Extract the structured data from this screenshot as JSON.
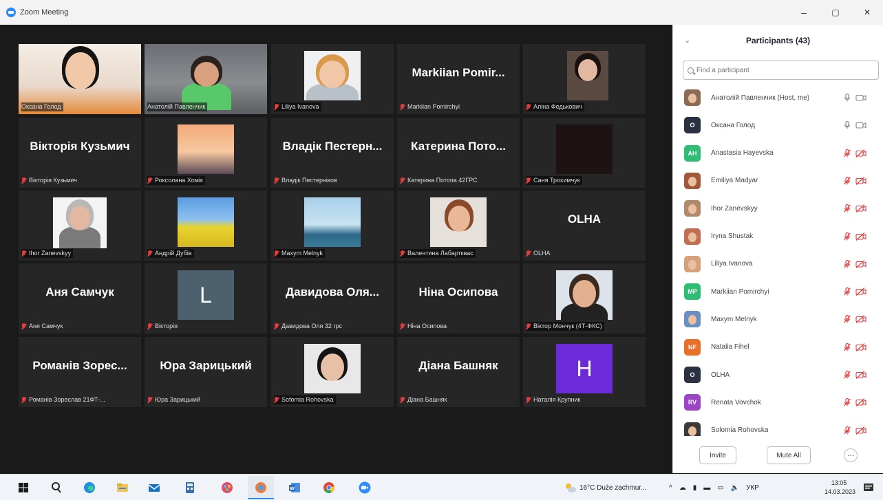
{
  "window": {
    "title": "Zoom Meeting",
    "minimize": "–",
    "maximize": "▢",
    "close": "✕"
  },
  "gallery": [
    {
      "label": "Оксана Голод",
      "video": true
    },
    {
      "label": "Анатолій Павленчик",
      "video": true,
      "active": true
    },
    {
      "label": "Liliya Ivanova",
      "muted": true,
      "video": true
    },
    {
      "big": "Markiian Pomir...",
      "label": "Markiian Pomirchyi",
      "muted": true
    },
    {
      "label": "Аліна Федькович",
      "muted": true,
      "video": true
    },
    {
      "big": "Вікторія Кузьмич",
      "label": "Вікторія Кузьмич",
      "muted": true
    },
    {
      "label": "Роксолана Хомік",
      "muted": true,
      "video": true
    },
    {
      "big": "Владік Пестерн...",
      "label": "Владік Пестерніков",
      "muted": true
    },
    {
      "big": "Катерина Пото...",
      "label": "Катерина Потопа 42ГРС",
      "muted": true
    },
    {
      "label": "Саня Трохимчук",
      "muted": true,
      "video": true
    },
    {
      "label": "Ihor Zanevskyy",
      "muted": true,
      "video": true
    },
    {
      "label": "Андрій Дубів",
      "muted": true,
      "video": true
    },
    {
      "label": "Maxym Melnyk",
      "muted": true,
      "video": true
    },
    {
      "label": "Валентина Лабартквас",
      "muted": true,
      "video": true
    },
    {
      "big": "OLHA",
      "label": "OLHA",
      "muted": true
    },
    {
      "big": "Аня Самчук",
      "label": "Аня Самчук",
      "muted": true
    },
    {
      "letter": "L",
      "label": "Вікторія",
      "muted": true
    },
    {
      "big": "Давидова Оля...",
      "label": "Давидова Оля 32 грс",
      "muted": true
    },
    {
      "big": "Ніна Осипова",
      "label": "Ніна Осипова",
      "muted": true
    },
    {
      "label": "Віктор Мончук (4Т-ФКС)",
      "muted": true,
      "video": true
    },
    {
      "big": "Романів Зорес...",
      "label": "Романів Зореслав 21ФТ-...",
      "muted": true
    },
    {
      "big": "Юра Зарицький",
      "label": "Юра Зарицький",
      "muted": true
    },
    {
      "label": "Sofomia Rohovska",
      "muted": true,
      "video": true
    },
    {
      "big": "Діана Башняк",
      "label": "Діана Башняк",
      "muted": true
    },
    {
      "letter": "H",
      "label": "Наталія Крупник",
      "muted": true
    }
  ],
  "panel": {
    "title": "Participants (43)",
    "collapse_icon": "⌄",
    "search_placeholder": "Find a participant",
    "participants": [
      {
        "name": "Анатолій Павленчик (Host, me)",
        "avatar": "photo",
        "color": "#8b6b52",
        "muted": false
      },
      {
        "name": "Оксана Голод",
        "avatar": "O",
        "color": "#2b3140",
        "muted": false
      },
      {
        "name": "Anastasia Hayevska",
        "avatar": "AH",
        "color": "#2ebd73",
        "muted": true
      },
      {
        "name": "Emiliya Madyar",
        "avatar": "photo",
        "color": "#a05a3a",
        "muted": true
      },
      {
        "name": "Ihor Zanevskyy",
        "avatar": "photo",
        "color": "#b08a6a",
        "muted": true
      },
      {
        "name": "Iryna Shustak",
        "avatar": "photo",
        "color": "#c07050",
        "muted": true
      },
      {
        "name": "Liliya Ivanova",
        "avatar": "photo",
        "color": "#d6a07a",
        "muted": true
      },
      {
        "name": "Markiian Pomirchyi",
        "avatar": "MP",
        "color": "#2ebd73",
        "muted": true
      },
      {
        "name": "Maxym Melnyk",
        "avatar": "photo",
        "color": "#6b8fc0",
        "muted": true
      },
      {
        "name": "Natalia Fihel",
        "avatar": "NF",
        "color": "#e8702a",
        "muted": true
      },
      {
        "name": "OLHA",
        "avatar": "O",
        "color": "#2b3140",
        "muted": true
      },
      {
        "name": "Renata Vovchok",
        "avatar": "RV",
        "color": "#9b46c4",
        "muted": true
      },
      {
        "name": "Solomia Rohovska",
        "avatar": "photo",
        "color": "#3a3a3a",
        "muted": true
      }
    ],
    "invite_label": "Invite",
    "mute_all_label": "Mute All",
    "more_label": "···"
  },
  "taskbar": {
    "weather": "16°C  Duże zachmur...",
    "lang": "УКР",
    "time": "13:05",
    "date": "14.03.2023"
  }
}
